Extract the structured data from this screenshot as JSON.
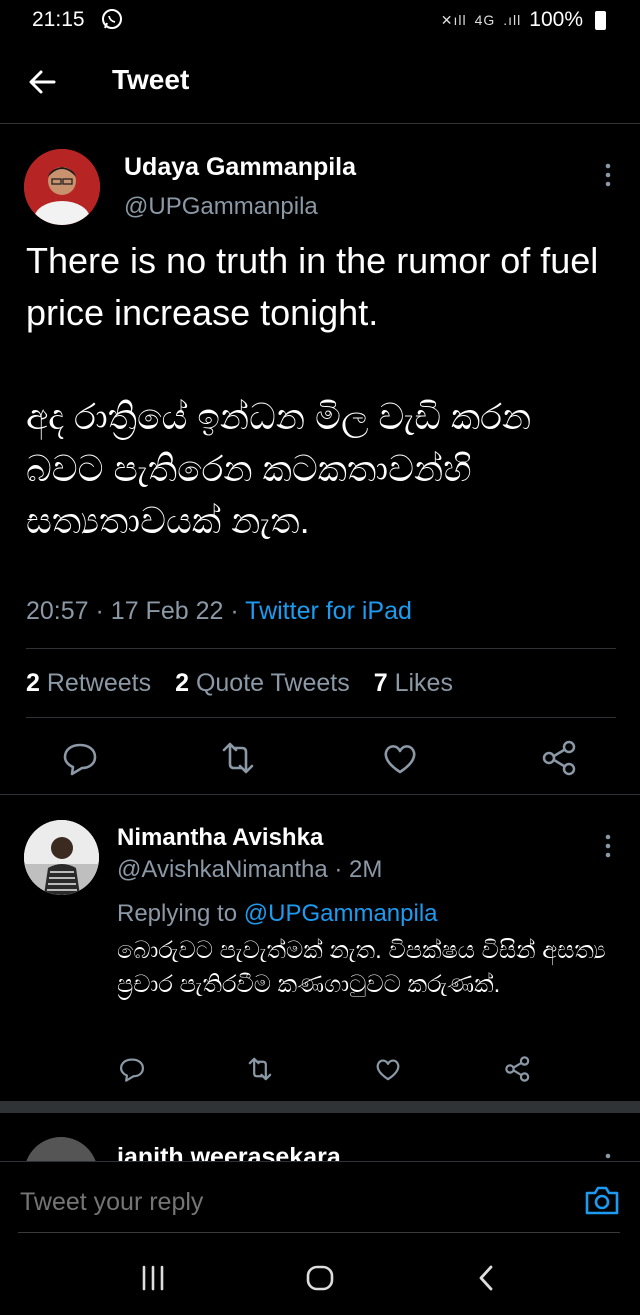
{
  "status_bar": {
    "time": "21:15",
    "network": "4G",
    "battery": "100%"
  },
  "header": {
    "title": "Tweet"
  },
  "tweet": {
    "author_name": "Udaya Gammanpila",
    "author_handle": "@UPGammanpila",
    "text": "There is no truth in the rumor of fuel price increase tonight.\n\nඅද රාත්‍රියේ ඉන්ධන මිල වැඩි කරන බවට පැතිරෙන කටකතාවන්හි සත්‍යතාවයක් නැත.",
    "time": "20:57",
    "date": "17 Feb 22",
    "source": "Twitter for iPad",
    "retweets_count": "2",
    "retweets_label": "Retweets",
    "quotes_count": "2",
    "quotes_label": "Quote Tweets",
    "likes_count": "7",
    "likes_label": "Likes"
  },
  "reply": {
    "author_name": "Nimantha Avishka",
    "author_handle": "@AvishkaNimantha",
    "age": "2M",
    "replying_prefix": "Replying to",
    "replying_to": "@UPGammanpila",
    "text": "බොරුවට පැවැත්මක් නැත. විපක්ෂය විසින් අසත්‍ය ප්‍රචාර පැතිරවීම කණගාටුවට කරුණක්."
  },
  "next_reply": {
    "author_name": "janith weerasekara"
  },
  "composer": {
    "placeholder": "Tweet your reply"
  },
  "colors": {
    "accent": "#1d9bf0",
    "muted": "#8b98a5",
    "divider": "#2f3336"
  }
}
